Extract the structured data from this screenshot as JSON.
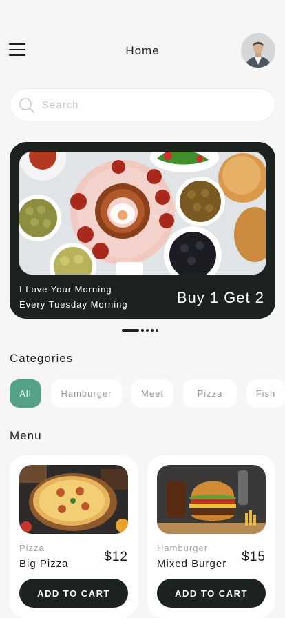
{
  "header": {
    "title": "Home",
    "menu_icon": "hamburger-menu-icon",
    "avatar_icon": "user-avatar"
  },
  "search": {
    "placeholder": "Search",
    "value": "",
    "icon": "search-icon"
  },
  "banner": {
    "line1": "I Love Your Morning",
    "line2": "Every Tuesday Morning",
    "promo": "Buy 1 Get 2",
    "image": "breakfast-spread-image",
    "slides_total": 5,
    "active_slide": 1
  },
  "categories": {
    "title": "Categories",
    "items": [
      {
        "label": "All",
        "active": true
      },
      {
        "label": "Hamburger",
        "active": false
      },
      {
        "label": "Meet",
        "active": false
      },
      {
        "label": "Pizza",
        "active": false
      },
      {
        "label": "Fish",
        "active": false
      }
    ]
  },
  "menu": {
    "title": "Menu",
    "items": [
      {
        "category": "Pizza",
        "name": "Big Pizza",
        "price": "$12",
        "button": "ADD TO CART",
        "image": "pizza-image"
      },
      {
        "category": "Hamburger",
        "name": "Mixed Burger",
        "price": "$15",
        "button": "ADD TO CART",
        "image": "burger-image"
      }
    ]
  },
  "colors": {
    "accent": "#55a185",
    "dark": "#1c2220",
    "background": "#f6f6f6"
  }
}
